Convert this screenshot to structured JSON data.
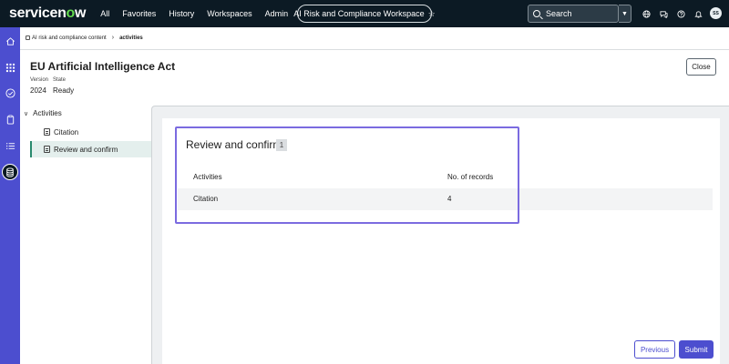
{
  "topbar": {
    "logo_main": "servicen",
    "logo_o": "o",
    "logo_end": "w",
    "nav": [
      "All",
      "Favorites",
      "History",
      "Workspaces",
      "Admin"
    ],
    "workspace_label": "AI Risk and Compliance Workspace",
    "workspace_star": "☆",
    "search_placeholder": "Search",
    "search_dropdown": "▼",
    "icons": [
      "globe-icon",
      "chat-icon",
      "help-icon",
      "bell-icon"
    ],
    "avatar_initials": "SS"
  },
  "rail": {
    "icons": [
      "home-icon",
      "apps-icon",
      "check-icon",
      "clipboard-icon",
      "list-icon",
      "database-icon"
    ]
  },
  "breadcrumb": {
    "parent": "AI risk and compliance content",
    "separator": "›",
    "current": "activities"
  },
  "record": {
    "title": "EU Artificial Intelligence Act",
    "version_label": "Version",
    "state_label": "State",
    "version_value": "2024",
    "state_value": "Ready"
  },
  "close_label": "Close",
  "tree": {
    "root": "Activities",
    "root_chevron": "∨",
    "items": [
      "Citation",
      "Review and confirm"
    ],
    "selected_index": 1
  },
  "review": {
    "title": "Review and confirm",
    "count": "1",
    "columns": [
      "Activities",
      "No. of records"
    ],
    "rows": [
      [
        "Citation",
        "4"
      ]
    ]
  },
  "buttons": {
    "previous": "Previous",
    "submit": "Submit"
  },
  "colors": {
    "topbar": "#0c1a24",
    "rail": "#4c4ecf",
    "accent": "#4c4ecf",
    "focus": "#7b6be0",
    "selected_bg": "#e4efed"
  }
}
